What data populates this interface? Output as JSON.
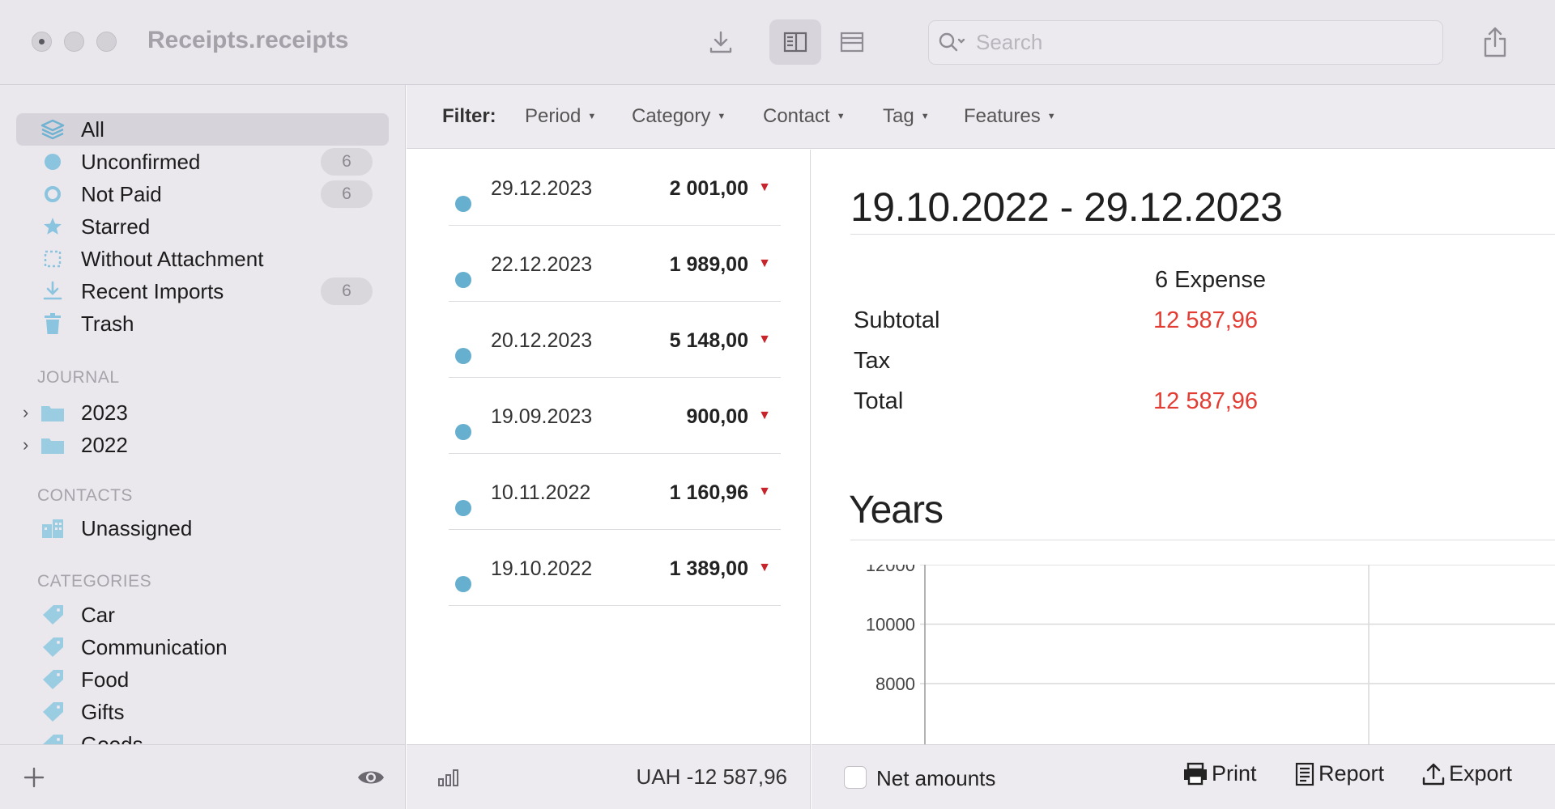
{
  "window": {
    "title": "Receipts.receipts",
    "search_placeholder": "Search"
  },
  "toolbar": {
    "icons": [
      "download-icon",
      "split-view-icon",
      "list-view-icon",
      "share-icon"
    ],
    "active_view": "split-view"
  },
  "sidebar": {
    "items": [
      {
        "label": "All",
        "icon": "stack-icon",
        "badge": ""
      },
      {
        "label": "Unconfirmed",
        "icon": "filled-circle-icon",
        "badge": "6"
      },
      {
        "label": "Not Paid",
        "icon": "ring-icon",
        "badge": "6"
      },
      {
        "label": "Starred",
        "icon": "star-icon",
        "badge": ""
      },
      {
        "label": "Without Attachment",
        "icon": "dotted-square-icon",
        "badge": ""
      },
      {
        "label": "Recent Imports",
        "icon": "import-icon",
        "badge": "6"
      },
      {
        "label": "Trash",
        "icon": "trash-icon",
        "badge": ""
      }
    ],
    "journal_title": "JOURNAL",
    "journal": [
      {
        "label": "2023"
      },
      {
        "label": "2022"
      }
    ],
    "contacts_title": "CONTACTS",
    "contacts": [
      {
        "label": "Unassigned"
      }
    ],
    "categories_title": "CATEGORIES",
    "categories": [
      {
        "label": "Car"
      },
      {
        "label": "Communication"
      },
      {
        "label": "Food"
      },
      {
        "label": "Gifts"
      },
      {
        "label": "Goods"
      }
    ]
  },
  "filter": {
    "label": "Filter:",
    "buttons": [
      "Period",
      "Category",
      "Contact",
      "Tag",
      "Features"
    ]
  },
  "receipts": [
    {
      "date": "29.12.2023",
      "amount": "2 001,00"
    },
    {
      "date": "22.12.2023",
      "amount": "1 989,00"
    },
    {
      "date": "20.12.2023",
      "amount": "5 148,00"
    },
    {
      "date": "19.09.2023",
      "amount": "900,00"
    },
    {
      "date": "10.11.2022",
      "amount": "1 160,96"
    },
    {
      "date": "19.10.2022",
      "amount": "1 389,00"
    }
  ],
  "list_footer": {
    "total": "UAH -12 587,96"
  },
  "detail": {
    "range": "19.10.2022 - 29.12.2023",
    "summary_header": "6 Expense",
    "subtotal_label": "Subtotal",
    "subtotal_value": "12 587,96",
    "tax_label": "Tax",
    "total_label": "Total",
    "total_value": "12 587,96",
    "years_title": "Years",
    "negative_color": "#e23c33",
    "accent_dot_color": "#66afcf"
  },
  "chart_data": {
    "type": "bar",
    "title": "Years",
    "yticks": [
      12000,
      10000,
      8000
    ],
    "ylim_visible": [
      8000,
      12000
    ],
    "grid": true,
    "categories": [],
    "values": []
  },
  "detail_footer": {
    "net_amounts_label": "Net amounts",
    "print_label": "Print",
    "report_label": "Report",
    "export_label": "Export"
  }
}
